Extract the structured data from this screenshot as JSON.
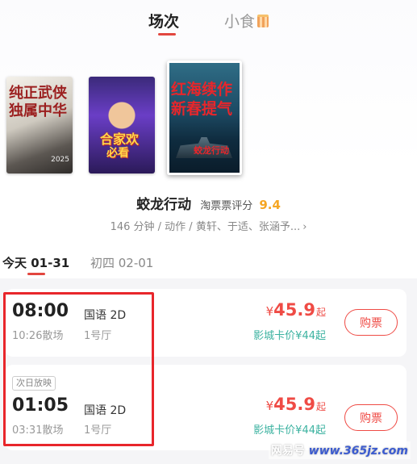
{
  "tabs": {
    "showtimes_label": "场次",
    "snacks_label": "小食",
    "snacks_icon": "popcorn-icon"
  },
  "posters": [
    {
      "line1": "纯正武侠",
      "line2": "独属中华",
      "year": "2025"
    },
    {
      "line1": "合家欢",
      "line2": "必看"
    },
    {
      "line1": "红海续作",
      "line2": "新春提气",
      "sub": "蛟龙行动"
    }
  ],
  "movie": {
    "title": "蛟龙行动",
    "rating_label": "淘票票评分",
    "rating": "9.4",
    "meta": "146 分钟 / 动作 / 黄轩、于适、张涵予...",
    "chevron_icon": "chevron-right-icon"
  },
  "dates": {
    "active": "今天 01-31",
    "next": "初四 02-01"
  },
  "showtimes": [
    {
      "tag": "",
      "start": "08:00",
      "end": "10:26散场",
      "lang": "国语 2D",
      "hall": "1号厅",
      "currency": "¥",
      "price": "45.9",
      "price_suffix": "起",
      "card_price": "影城卡价¥44起",
      "buy_label": "购票"
    },
    {
      "tag": "次日放映",
      "start": "01:05",
      "end": "03:31散场",
      "lang": "国语 2D",
      "hall": "1号厅",
      "currency": "¥",
      "price": "45.9",
      "price_suffix": "起",
      "card_price": "影城卡价¥44起",
      "buy_label": "购票"
    }
  ],
  "watermark": {
    "brand": "网易号",
    "site": "www.365jz.com"
  },
  "colors": {
    "accent": "#ef4b45",
    "rating": "#f5a623",
    "card_price": "#3bb2a0"
  }
}
